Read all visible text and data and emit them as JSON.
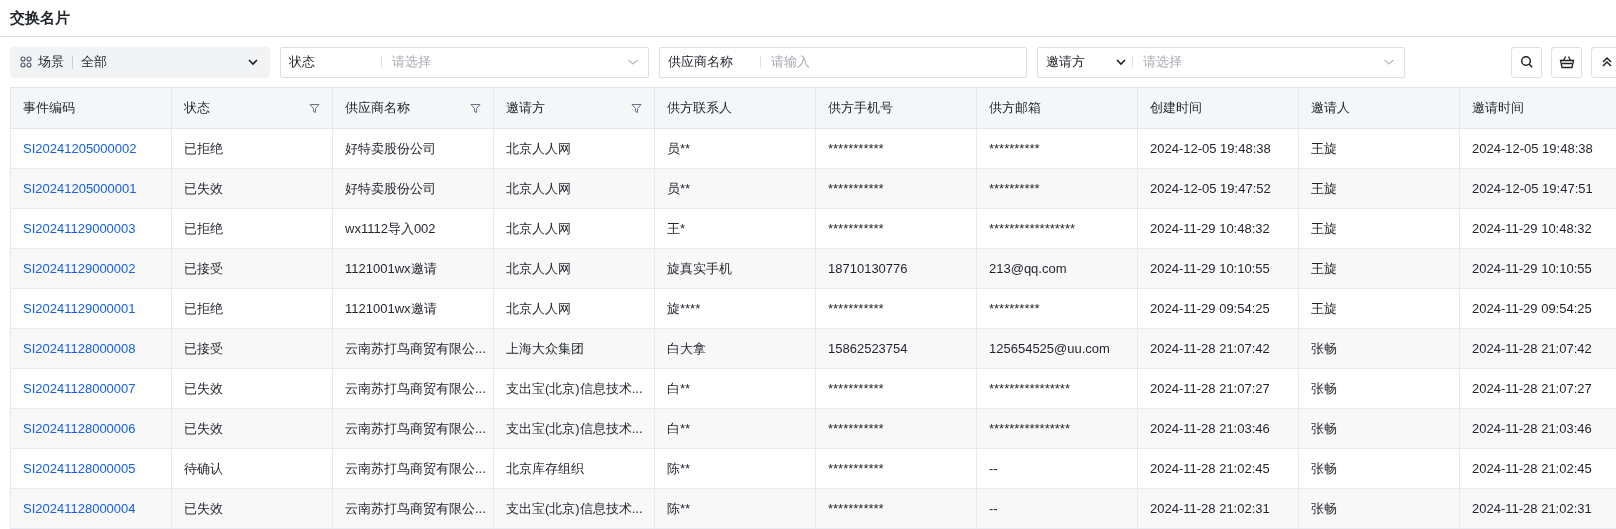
{
  "title": "交换名片",
  "scene": {
    "label": "场景",
    "value": "全部"
  },
  "filters": [
    {
      "kind": "select",
      "label": "状态",
      "placeholder": "请选择"
    },
    {
      "kind": "input",
      "label": "供应商名称",
      "placeholder": "请输入"
    },
    {
      "kind": "dropdown-select",
      "label": "邀请方",
      "placeholder": "请选择"
    }
  ],
  "toolbar": [
    {
      "kind": "search"
    },
    {
      "kind": "basket"
    },
    {
      "kind": "collapse"
    }
  ],
  "table": {
    "columns": [
      {
        "label": "事件编码",
        "filterable": false
      },
      {
        "label": "状态",
        "filterable": true
      },
      {
        "label": "供应商名称",
        "filterable": true
      },
      {
        "label": "邀请方",
        "filterable": true
      },
      {
        "label": "供方联系人",
        "filterable": false
      },
      {
        "label": "供方手机号",
        "filterable": false
      },
      {
        "label": "供方邮箱",
        "filterable": false
      },
      {
        "label": "创建时间",
        "filterable": false
      },
      {
        "label": "邀请人",
        "filterable": false
      },
      {
        "label": "邀请时间",
        "filterable": false
      }
    ],
    "rows": [
      [
        "SI20241205000002",
        "已拒绝",
        "好特卖股份公司",
        "北京人人网",
        "员**",
        "***********",
        "**********",
        "2024-12-05 19:48:38",
        "王旋",
        "2024-12-05 19:48:38"
      ],
      [
        "SI20241205000001",
        "已失效",
        "好特卖股份公司",
        "北京人人网",
        "员**",
        "***********",
        "**********",
        "2024-12-05 19:47:52",
        "王旋",
        "2024-12-05 19:47:51"
      ],
      [
        "SI20241129000003",
        "已拒绝",
        "wx1112导入002",
        "北京人人网",
        "王*",
        "***********",
        "*****************",
        "2024-11-29 10:48:32",
        "王旋",
        "2024-11-29 10:48:32"
      ],
      [
        "SI20241129000002",
        "已接受",
        "1121001wx邀请",
        "北京人人网",
        "旋真实手机",
        "18710130776",
        "213@qq.com",
        "2024-11-29 10:10:55",
        "王旋",
        "2024-11-29 10:10:55"
      ],
      [
        "SI20241129000001",
        "已拒绝",
        "1121001wx邀请",
        "北京人人网",
        "旋****",
        "***********",
        "**********",
        "2024-11-29 09:54:25",
        "王旋",
        "2024-11-29 09:54:25"
      ],
      [
        "SI20241128000008",
        "已接受",
        "云南苏打鸟商贸有限公...",
        "上海大众集团",
        "白大拿",
        "15862523754",
        "125654525@uu.com",
        "2024-11-28 21:07:42",
        "张畅",
        "2024-11-28 21:07:42"
      ],
      [
        "SI20241128000007",
        "已失效",
        "云南苏打鸟商贸有限公...",
        "支出宝(北京)信息技术...",
        "白**",
        "***********",
        "****************",
        "2024-11-28 21:07:27",
        "张畅",
        "2024-11-28 21:07:27"
      ],
      [
        "SI20241128000006",
        "已失效",
        "云南苏打鸟商贸有限公...",
        "支出宝(北京)信息技术...",
        "白**",
        "***********",
        "****************",
        "2024-11-28 21:03:46",
        "张畅",
        "2024-11-28 21:03:46"
      ],
      [
        "SI20241128000005",
        "待确认",
        "云南苏打鸟商贸有限公...",
        "北京库存组织",
        "陈**",
        "***********",
        "--",
        "2024-11-28 21:02:45",
        "张畅",
        "2024-11-28 21:02:45"
      ],
      [
        "SI20241128000004",
        "已失效",
        "云南苏打鸟商贸有限公...",
        "支出宝(北京)信息技术...",
        "陈**",
        "***********",
        "--",
        "2024-11-28 21:02:31",
        "张畅",
        "2024-11-28 21:02:31"
      ]
    ]
  }
}
